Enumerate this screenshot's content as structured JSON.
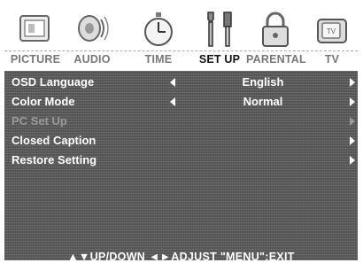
{
  "tabs": [
    {
      "label": "PICTURE",
      "icon": "tv-picture-icon"
    },
    {
      "label": "AUDIO",
      "icon": "speaker-icon"
    },
    {
      "label": "TIME",
      "icon": "stopwatch-icon"
    },
    {
      "label": "SET UP",
      "icon": "tools-icon",
      "active": true
    },
    {
      "label": "PARENTAL",
      "icon": "padlock-icon"
    },
    {
      "label": "TV",
      "icon": "tv-icon"
    }
  ],
  "menu": {
    "rows": [
      {
        "label": "OSD Language",
        "value": "English"
      },
      {
        "label": "Color Mode",
        "value": "Normal"
      },
      {
        "label": "PC Set Up",
        "value": ""
      },
      {
        "label": "Closed Caption",
        "value": ""
      },
      {
        "label": "Restore Setting",
        "value": ""
      }
    ]
  },
  "footer": {
    "hint": "▲▼UP/DOWN  ◄►ADJUST  \"MENU\":EXIT"
  }
}
